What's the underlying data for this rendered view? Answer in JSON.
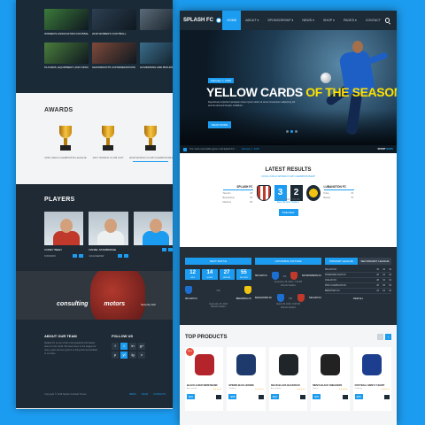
{
  "colors": {
    "accent": "#1c9cf0",
    "dark": "#1d2b36",
    "highlight": "#ffe100"
  },
  "back_page": {
    "news": [
      {
        "caption": "WOMEN'S ASSOCIATION FOOTBALL",
        "image": "#3b7a3a"
      },
      {
        "caption": "2018 WOMEN'S FOOTBALL",
        "image": "#2d3f52"
      },
      {
        "caption": "",
        "image": "#5a6b78"
      },
      {
        "caption": "PLAYERS, EQUIPMENT, AND OFFICIALS",
        "image": "#4a7d3c"
      },
      {
        "caption": "GRASSROOTS CONSIDERATIONS",
        "image": "#7e4a3a"
      },
      {
        "caption": "GOVERNING AND BUILDING METHODS",
        "image": "#3a6c8a"
      }
    ],
    "awards_title": "AWARDS",
    "awards": [
      {
        "caption": "2016 UEFA CHAMPIONS LEAGUE"
      },
      {
        "caption": "2017 WORLD CLUB CUP"
      },
      {
        "caption": "2018 WORLD CLUB CHAMPIONSHIP"
      }
    ],
    "players_title": "PLAYERS",
    "players": [
      {
        "name": "COREY BEEN",
        "position": "FORWARD",
        "shirt": "#c0392b"
      },
      {
        "name": "DANIEL STARBRIDGE",
        "position": "GOALKEEPER",
        "shirt": "#ecf0f1"
      },
      {
        "name": "",
        "position": "",
        "shirt": "#1c9cf0"
      }
    ],
    "sponsors": [
      "consulting",
      "motors",
      "Security Sch"
    ],
    "footer": {
      "about_title": "ABOUT OUR TEAM",
      "about_text": "Splash FC is one of the most powerful and fastest teams in the world. We have been in the league for many years and our goal is to bring the best football to our fans.",
      "follow_title": "FOLLOW US",
      "social": [
        "f",
        "t",
        "in",
        "g+",
        "p",
        "yt",
        "ig",
        "v"
      ],
      "copyright": "Copyright © 2018 Splash Football Theme",
      "links": [
        "NEWS",
        "TEAM",
        "CONTACTS"
      ]
    }
  },
  "front_page": {
    "logo": "SPLASH FC",
    "nav": [
      "HOME",
      "ABOUT ▾",
      "SPONSORSHIP ▾",
      "NEWS ▾",
      "SHOP ▾",
      "PAGES ▾",
      "CONTACT"
    ],
    "hero": {
      "date": "February 7, 2018",
      "title_main": "YELLOW CARDS",
      "title_highlight": "OF THE SEASON",
      "text": "Figuratively imperfect quisquam lorem ipsum dolor sit amet consectetur adipiscing elit sed do eiusmod tempor incididunt.",
      "button": "READ MORE"
    },
    "ticker": {
      "text": "The most memorable game in all Splash FC...",
      "date": "February 7, 2018",
      "label_a": "SPORT",
      "label_b": "NEWS"
    },
    "latest": {
      "title": "LATEST RESULTS",
      "competition": "COCA COLA WORLD CUP CHAMPIONSHIP",
      "home": {
        "name": "SPLASH FC",
        "score": "3",
        "scorers": [
          [
            "Tarentin",
            "45'"
          ],
          [
            "Beauchamp",
            "60'"
          ],
          [
            "Martinez",
            "90'"
          ]
        ]
      },
      "away": {
        "name": "LUBANGTON FC",
        "score": "2",
        "scorers": [
          [
            "Pulse",
            "15'"
          ],
          [
            "Bastyk",
            "70'"
          ]
        ]
      },
      "date": "June 7, 2018 • 7:30 PM",
      "venue": "New Olimpick Stadium",
      "button": "PREVIEW"
    },
    "widgets": {
      "next_match": {
        "title": "NEXT MATCH",
        "countdown": [
          [
            "12",
            "DAYS"
          ],
          [
            "14",
            "HOURS"
          ],
          [
            "27",
            "MINUTES"
          ],
          [
            "55",
            "SECONDS"
          ]
        ],
        "home": "SPLASH FC",
        "away": "BRENDING FC",
        "vs": "VS",
        "date": "September 25, 2018",
        "venue": "Orlando Stadium"
      },
      "upcoming": {
        "title": "UPCOMING FIXTURE",
        "fixtures": [
          {
            "home": "SPLASH FC",
            "away": "RAYMONDSON FC",
            "date": "September 25, 2018 • 7:30 PM",
            "venue": "Orlando Stadium"
          },
          {
            "home": "BANGDOWN FC",
            "away": "SPLASH FC",
            "date": "March 28, 2019 • 9:00 PM",
            "venue": "Orlando Stadium"
          }
        ]
      },
      "league": {
        "tab_primary": "PRIMARY LEAGUE",
        "tab_secondary": "SECONDARY LEAGUE",
        "rows": [
          {
            "name": "SPLASH FC",
            "w": "32",
            "d": "04",
            "l": "02"
          },
          {
            "name": "RIVERSIDE CELTICS",
            "w": "30",
            "d": "04",
            "l": "04"
          },
          {
            "name": "AVALON FC",
            "w": "28",
            "d": "04",
            "l": "04"
          },
          {
            "name": "PINK FLAMINGOS FC",
            "w": "26",
            "d": "06",
            "l": "03"
          },
          {
            "name": "BRENTNEY FC",
            "w": "24",
            "d": "04",
            "l": "04"
          }
        ],
        "view_all": "VIEW ALL"
      }
    },
    "products": {
      "title": "TOP PRODUCTS",
      "items": [
        {
          "name": "BLACK & RED WRISTBAND",
          "category": "Accessories",
          "price": "$20",
          "sale": "SALE",
          "color": "#b3242b"
        },
        {
          "name": "SPEDDI BLUE HOODIE",
          "category": "Clothing",
          "price": "$88",
          "sale": "",
          "color": "#1e3a6d"
        },
        {
          "name": "SOLID BLACK BACKPACK",
          "category": "Accessories",
          "price": "$20",
          "sale": "",
          "color": "#1f2529"
        },
        {
          "name": "MEN'S BLACK SNEAKERS",
          "category": "Shoes",
          "price": "$70",
          "sale": "",
          "color": "#222222"
        },
        {
          "name": "FOOTBALL MEN'S T-SHIRT",
          "category": "Clothing",
          "price": "$35",
          "sale": "",
          "color": "#1d3d8f"
        }
      ],
      "rating": "★★★★★",
      "prev": "‹",
      "next": "›"
    }
  }
}
